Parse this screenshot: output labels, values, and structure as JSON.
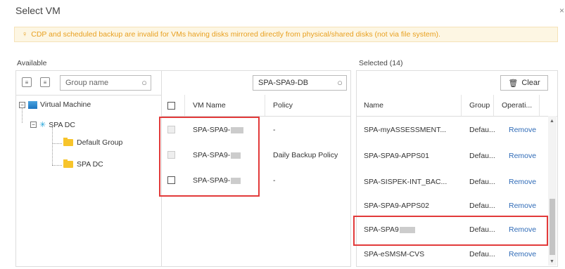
{
  "dialog": {
    "title": "Select VM",
    "close": "×"
  },
  "banner": {
    "text": "CDP and scheduled backup are invalid for VMs having disks mirrored directly from physical/shared disks (not via file system)."
  },
  "available": {
    "label": "Available",
    "group_search_placeholder": "Group name",
    "tree": {
      "root": "Virtual Machine",
      "datacenter": "SPA DC",
      "groups": [
        "Default Group",
        "SPA DC"
      ]
    },
    "vm_search_value": "SPA-SPA9-DB",
    "columns": {
      "name": "VM Name",
      "policy": "Policy"
    },
    "rows": [
      {
        "name": "SPA-SPA9-",
        "policy": "-"
      },
      {
        "name": "SPA-SPA9-",
        "policy": "Daily Backup Policy"
      },
      {
        "name": "SPA-SPA9-",
        "policy": "-"
      }
    ]
  },
  "selected": {
    "label": "Selected (14)",
    "clear_label": "Clear",
    "columns": {
      "name": "Name",
      "group": "Group",
      "ops": "Operati..."
    },
    "rows": [
      {
        "name": "SPA-myASSESSMENT...",
        "group": "Defau...",
        "action": "Remove"
      },
      {
        "name": "SPA-SPA9-APPS01",
        "group": "Defau...",
        "action": "Remove"
      },
      {
        "name": "SPA-SISPEK-INT_BAC...",
        "group": "Defau...",
        "action": "Remove"
      },
      {
        "name": "SPA-SPA9-APPS02",
        "group": "Defau...",
        "action": "Remove"
      },
      {
        "name": "SPA-SPA9",
        "group": "Defau...",
        "action": "Remove"
      },
      {
        "name": "SPA-eSMSM-CVS",
        "group": "Defau...",
        "action": "Remove"
      }
    ]
  },
  "colors": {
    "accent_link": "#2f6bb7",
    "highlight_red": "#e23a3a",
    "banner_text": "#e8a020"
  }
}
